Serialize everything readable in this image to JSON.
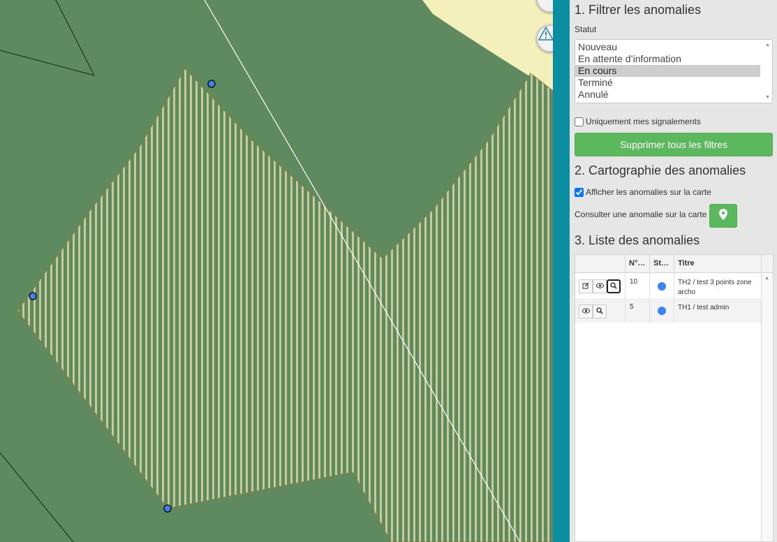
{
  "filters": {
    "title": "1. Filtrer les anomalies",
    "status_label": "Statut",
    "status_options": [
      "Nouveau",
      "En attente d’information",
      "En cours",
      "Terminé",
      "Annulé"
    ],
    "selected_status": "En cours",
    "only_mine_label": "Uniquement mes signalements",
    "only_mine_checked": false,
    "clear_button": "Supprimer tous les filtres"
  },
  "mapping": {
    "title": "2. Cartographie des anomalies",
    "show_on_map_label": "Afficher les anomalies sur la carte",
    "show_on_map_checked": true,
    "consult_label": "Consulter une anomalie sur la carte"
  },
  "list": {
    "title": "3. Liste des anomalies",
    "columns": [
      "",
      "N°…",
      "St…",
      "Titre"
    ],
    "rows": [
      {
        "number": "10",
        "status_color": "#3b82f6",
        "title": "TH2 / test 3 points zone archo"
      },
      {
        "number": "5",
        "status_color": "#3b82f6",
        "title": "TH1 / test admin"
      }
    ]
  },
  "colors": {
    "map_green": "#5f8a60",
    "map_yellow": "#f4f0bc",
    "teal": "#0b8ea1",
    "primary_green": "#5cb85c",
    "status_dot": "#3b82f6"
  },
  "icons": {
    "map_buttons": [
      "grid-icon",
      "warning-icon"
    ],
    "locate": "map-marker-icon",
    "row_actions": [
      "edit-icon",
      "eye-icon",
      "zoom-icon"
    ]
  }
}
